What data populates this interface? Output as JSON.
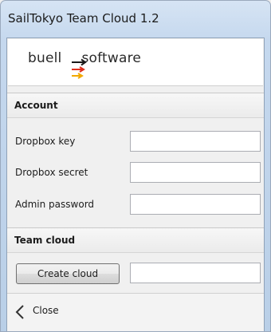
{
  "window": {
    "title": "SailTokyo Team Cloud 1.2"
  },
  "logo": {
    "text_left": "buell",
    "text_right": "software",
    "arrow_colors": [
      "#1a1a1a",
      "#e0301e",
      "#f2a900"
    ]
  },
  "account": {
    "title": "Account",
    "fields": [
      {
        "label": "Dropbox key",
        "value": ""
      },
      {
        "label": "Dropbox secret",
        "value": ""
      },
      {
        "label": "Admin password",
        "value": ""
      }
    ]
  },
  "team_cloud": {
    "title": "Team cloud",
    "create_button_label": "Create cloud",
    "cloud_name_value": ""
  },
  "footer": {
    "close_label": "Close",
    "close_icon": "chevron-left-icon"
  }
}
